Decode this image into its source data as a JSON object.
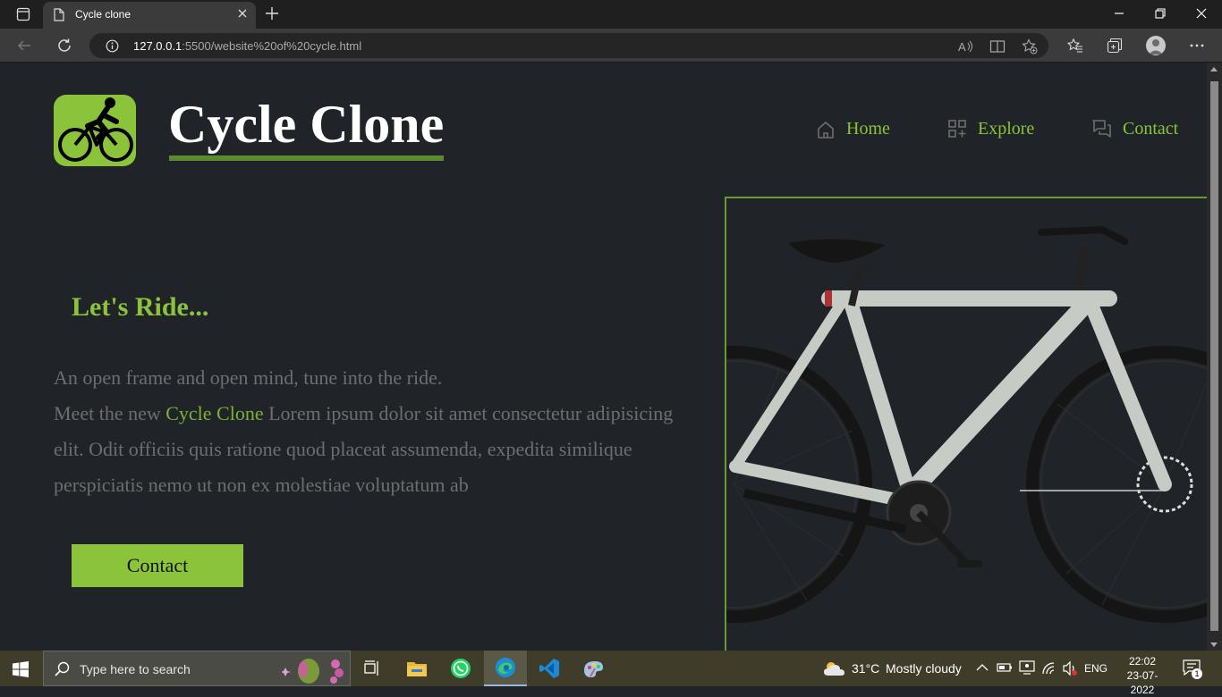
{
  "browser": {
    "tab_title": "Cycle clone",
    "url_host": "127.0.0.1",
    "url_rest": ":5500/website%20of%20cycle.html"
  },
  "site": {
    "brand": "Cycle Clone",
    "nav": [
      {
        "label": "Home",
        "icon": "home-icon"
      },
      {
        "label": "Explore",
        "icon": "grid-icon"
      },
      {
        "label": "Contact",
        "icon": "chat-icon"
      }
    ],
    "hero": {
      "title": "Let's Ride...",
      "line1": "An open frame and open mind, tune into the ride.",
      "meet_prefix": "Meet the new ",
      "meet_brand": "Cycle Clone",
      "meet_suffix": " Lorem ipsum dolor sit amet consectetur adipisicing elit. Odit officiis quis ratione quod placeat assumenda, expedita similique perspiciatis nemo ut non ex molestiae voluptatum ab",
      "cta_label": "Contact"
    },
    "colors": {
      "accent": "#8bc43a",
      "background": "#202327"
    }
  },
  "taskbar": {
    "search_placeholder": "Type here to search",
    "weather_temp": "31°C",
    "weather_text": "Mostly cloudy",
    "language": "ENG",
    "time": "22:02",
    "date": "23-07-2022",
    "notification_count": "1"
  }
}
